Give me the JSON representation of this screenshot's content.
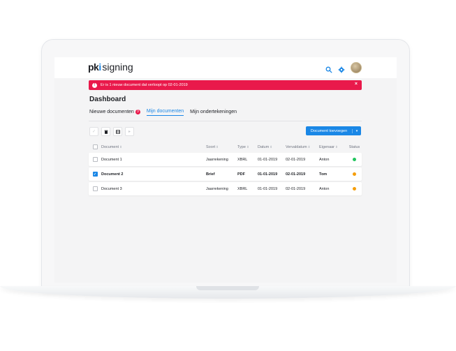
{
  "app": {
    "logo_pk": "pk",
    "logo_i": "i",
    "logo_signing": "signing"
  },
  "header": {
    "icons": [
      "search-icon",
      "gear-icon",
      "avatar"
    ]
  },
  "alert": {
    "text": "Er is 1 nieuw document dat verloopt op 02-01-2019",
    "close": "×",
    "color": "#e9194b"
  },
  "page": {
    "title": "Dashboard"
  },
  "tabs": [
    {
      "label": "Nieuwe documenten",
      "badge": "3",
      "active": false
    },
    {
      "label": "Mijn documenten",
      "active": true
    },
    {
      "label": "Mijn ondertekeningen",
      "active": false
    }
  ],
  "toolbar": {
    "buttons": [
      "check-icon",
      "trash-icon",
      "archive-icon",
      "play-icon"
    ],
    "add_label": "Document toevoegen",
    "add_caret": "▾",
    "accent": "#1a87e6"
  },
  "table": {
    "columns": [
      "Document",
      "Soort",
      "Type",
      "Datum",
      "Vervaldatum",
      "Eigenaar",
      "Status"
    ],
    "rows": [
      {
        "document": "Document 1",
        "soort": "Jaarrekening",
        "type": "XBRL",
        "datum": "01-01-2019",
        "vervaldatum": "02-01-2019",
        "eigenaar": "Anton",
        "status_color": "#22c55e",
        "checked": false
      },
      {
        "document": "Document 2",
        "soort": "Brief",
        "type": "PDF",
        "datum": "01-01-2019",
        "vervaldatum": "02-01-2019",
        "eigenaar": "Tom",
        "status_color": "#f59e0b",
        "checked": true
      },
      {
        "document": "Document 3",
        "soort": "Jaarrekening",
        "type": "XBRL",
        "datum": "01-01-2019",
        "vervaldatum": "02-01-2019",
        "eigenaar": "Anton",
        "status_color": "#f59e0b",
        "checked": false
      }
    ]
  }
}
